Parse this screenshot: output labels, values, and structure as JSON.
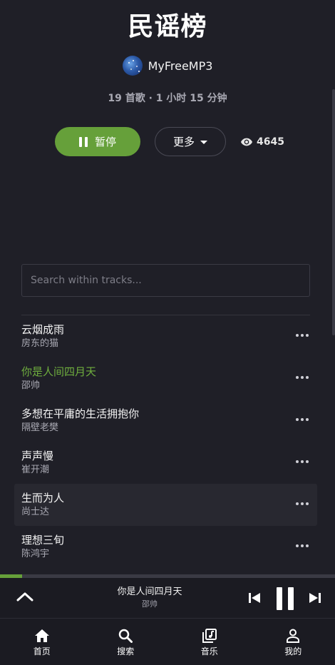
{
  "playlist": {
    "title": "民谣榜",
    "owner": "MyFreeMP3",
    "meta": "19 首歌 · 1 小时 15 分钟",
    "views": "4645"
  },
  "actions": {
    "pause_label": "暂停",
    "more_label": "更多"
  },
  "search": {
    "placeholder": "Search within tracks..."
  },
  "tracks": [
    {
      "title": "云烟成雨",
      "artist": "房东的猫"
    },
    {
      "title": "你是人间四月天",
      "artist": "邵帅",
      "playing": true
    },
    {
      "title": "多想在平庸的生活拥抱你",
      "artist": "隔壁老樊"
    },
    {
      "title": "声声慢",
      "artist": "崔开潮"
    },
    {
      "title": "生而为人",
      "artist": "尚士达",
      "hover": true
    },
    {
      "title": "理想三旬",
      "artist": "陈鸿宇"
    }
  ],
  "now_playing": {
    "title": "你是人间四月天",
    "artist": "邵帅",
    "progress": 0.066
  },
  "nav": [
    {
      "label": "首页",
      "icon": "home-icon"
    },
    {
      "label": "搜索",
      "icon": "search-icon"
    },
    {
      "label": "音乐",
      "icon": "music-library-icon"
    },
    {
      "label": "我的",
      "icon": "profile-icon"
    }
  ],
  "colors": {
    "background": "#1f1f27",
    "accent": "#66a03a",
    "playing_text": "#6fae3e"
  }
}
